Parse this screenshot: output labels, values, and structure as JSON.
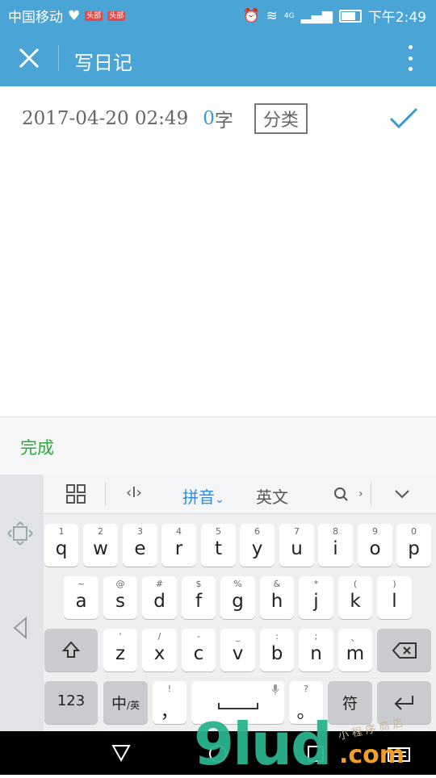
{
  "status": {
    "carrier": "中国移动",
    "badge1": "头部",
    "badge2": "头部",
    "net": "4G",
    "time": "下午2:49"
  },
  "appbar": {
    "title": "写日记"
  },
  "entry": {
    "date": "2017-04-20 02:49",
    "count": "0",
    "unit": "字",
    "category": "分类"
  },
  "done_label": "完成",
  "keyboard": {
    "tabs": {
      "pinyin": "拼音",
      "english": "英文"
    },
    "row1": [
      {
        "n": "1",
        "c": "q"
      },
      {
        "n": "2",
        "c": "w"
      },
      {
        "n": "3",
        "c": "e"
      },
      {
        "n": "4",
        "c": "r"
      },
      {
        "n": "5",
        "c": "t"
      },
      {
        "n": "6",
        "c": "y"
      },
      {
        "n": "7",
        "c": "u"
      },
      {
        "n": "8",
        "c": "i"
      },
      {
        "n": "9",
        "c": "o"
      },
      {
        "n": "0",
        "c": "p"
      }
    ],
    "row2": [
      {
        "n": "~",
        "c": "a"
      },
      {
        "n": "@",
        "c": "s"
      },
      {
        "n": "#",
        "c": "d"
      },
      {
        "n": "$",
        "c": "f"
      },
      {
        "n": "%",
        "c": "g"
      },
      {
        "n": "&",
        "c": "h"
      },
      {
        "n": "*",
        "c": "j"
      },
      {
        "n": "(",
        "c": "k"
      },
      {
        "n": ")",
        "c": "l"
      }
    ],
    "row3": [
      {
        "n": "'",
        "c": "z"
      },
      {
        "n": "/",
        "c": "x"
      },
      {
        "n": "-",
        "c": "c"
      },
      {
        "n": "_",
        "c": "v"
      },
      {
        "n": ":",
        "c": "b"
      },
      {
        "n": ";",
        "c": "n"
      },
      {
        "n": "、",
        "c": "m"
      }
    ],
    "key123": "123",
    "zh": "中",
    "zh_sub": "/英",
    "comma_n": "!",
    "comma": "，",
    "period_n": "?",
    "period": "。",
    "symbol": "符"
  },
  "watermark": {
    "main": "9lud",
    "suffix": ".com",
    "small": "小 程 序 商 店"
  }
}
